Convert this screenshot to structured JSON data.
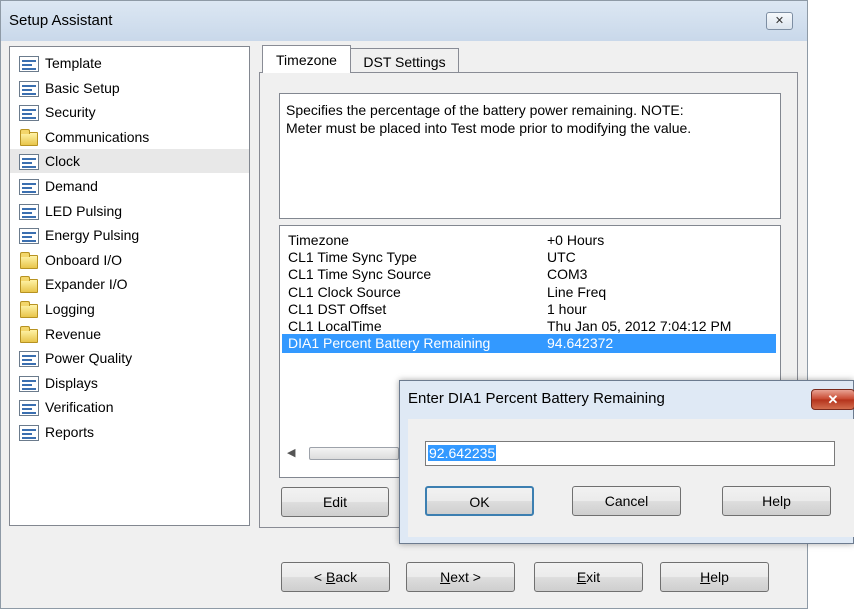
{
  "window": {
    "title": "Setup Assistant",
    "close_glyph": "✕"
  },
  "nav": {
    "items": [
      {
        "label": "Template",
        "icon": "document-icon"
      },
      {
        "label": "Basic Setup",
        "icon": "document-icon"
      },
      {
        "label": "Security",
        "icon": "document-icon"
      },
      {
        "label": "Communications",
        "icon": "folder-icon"
      },
      {
        "label": "Clock",
        "icon": "document-icon",
        "selected": true
      },
      {
        "label": "Demand",
        "icon": "document-icon"
      },
      {
        "label": "LED Pulsing",
        "icon": "document-icon"
      },
      {
        "label": "Energy Pulsing",
        "icon": "document-icon"
      },
      {
        "label": "Onboard I/O",
        "icon": "folder-icon"
      },
      {
        "label": "Expander I/O",
        "icon": "folder-icon"
      },
      {
        "label": "Logging",
        "icon": "folder-icon"
      },
      {
        "label": "Revenue",
        "icon": "folder-icon"
      },
      {
        "label": "Power Quality",
        "icon": "document-icon"
      },
      {
        "label": "Displays",
        "icon": "document-icon"
      },
      {
        "label": "Verification",
        "icon": "document-icon"
      },
      {
        "label": "Reports",
        "icon": "document-icon"
      }
    ]
  },
  "tabs": [
    {
      "label": "Timezone",
      "active": true
    },
    {
      "label": "DST Settings",
      "active": false
    }
  ],
  "description": {
    "line1": "Specifies the percentage of the battery power remaining.  NOTE:",
    "line2": "Meter must be placed into Test mode prior to modifying the value."
  },
  "settings": {
    "rows": [
      {
        "name": "Timezone",
        "value": "+0 Hours"
      },
      {
        "name": "CL1 Time Sync Type",
        "value": "UTC"
      },
      {
        "name": "CL1 Time Sync Source",
        "value": "COM3"
      },
      {
        "name": "CL1 Clock Source",
        "value": "Line Freq"
      },
      {
        "name": "CL1 DST Offset",
        "value": "1 hour"
      },
      {
        "name": "CL1 LocalTime",
        "value": "Thu Jan 05, 2012 7:04:12 PM"
      },
      {
        "name": "DIA1 Percent Battery Remaining",
        "value": "94.642372",
        "selected": true
      }
    ]
  },
  "panel_buttons": {
    "edit": "Edit"
  },
  "footer": {
    "back": {
      "mnemonic": "B",
      "rest": "ack",
      "prefix": "< "
    },
    "next": {
      "mnemonic": "N",
      "rest": "ext >"
    },
    "exit": {
      "mnemonic": "E",
      "rest": "xit"
    },
    "help": {
      "mnemonic": "H",
      "rest": "elp"
    }
  },
  "dialog": {
    "title": "Enter DIA1 Percent Battery Remaining",
    "close_glyph": "✕",
    "input_value": "92.642235",
    "ok_label": "OK",
    "cancel_label": "Cancel",
    "help_label": "Help"
  },
  "colors": {
    "selection": "#3399ff",
    "dialog_close": "#c7452c"
  }
}
